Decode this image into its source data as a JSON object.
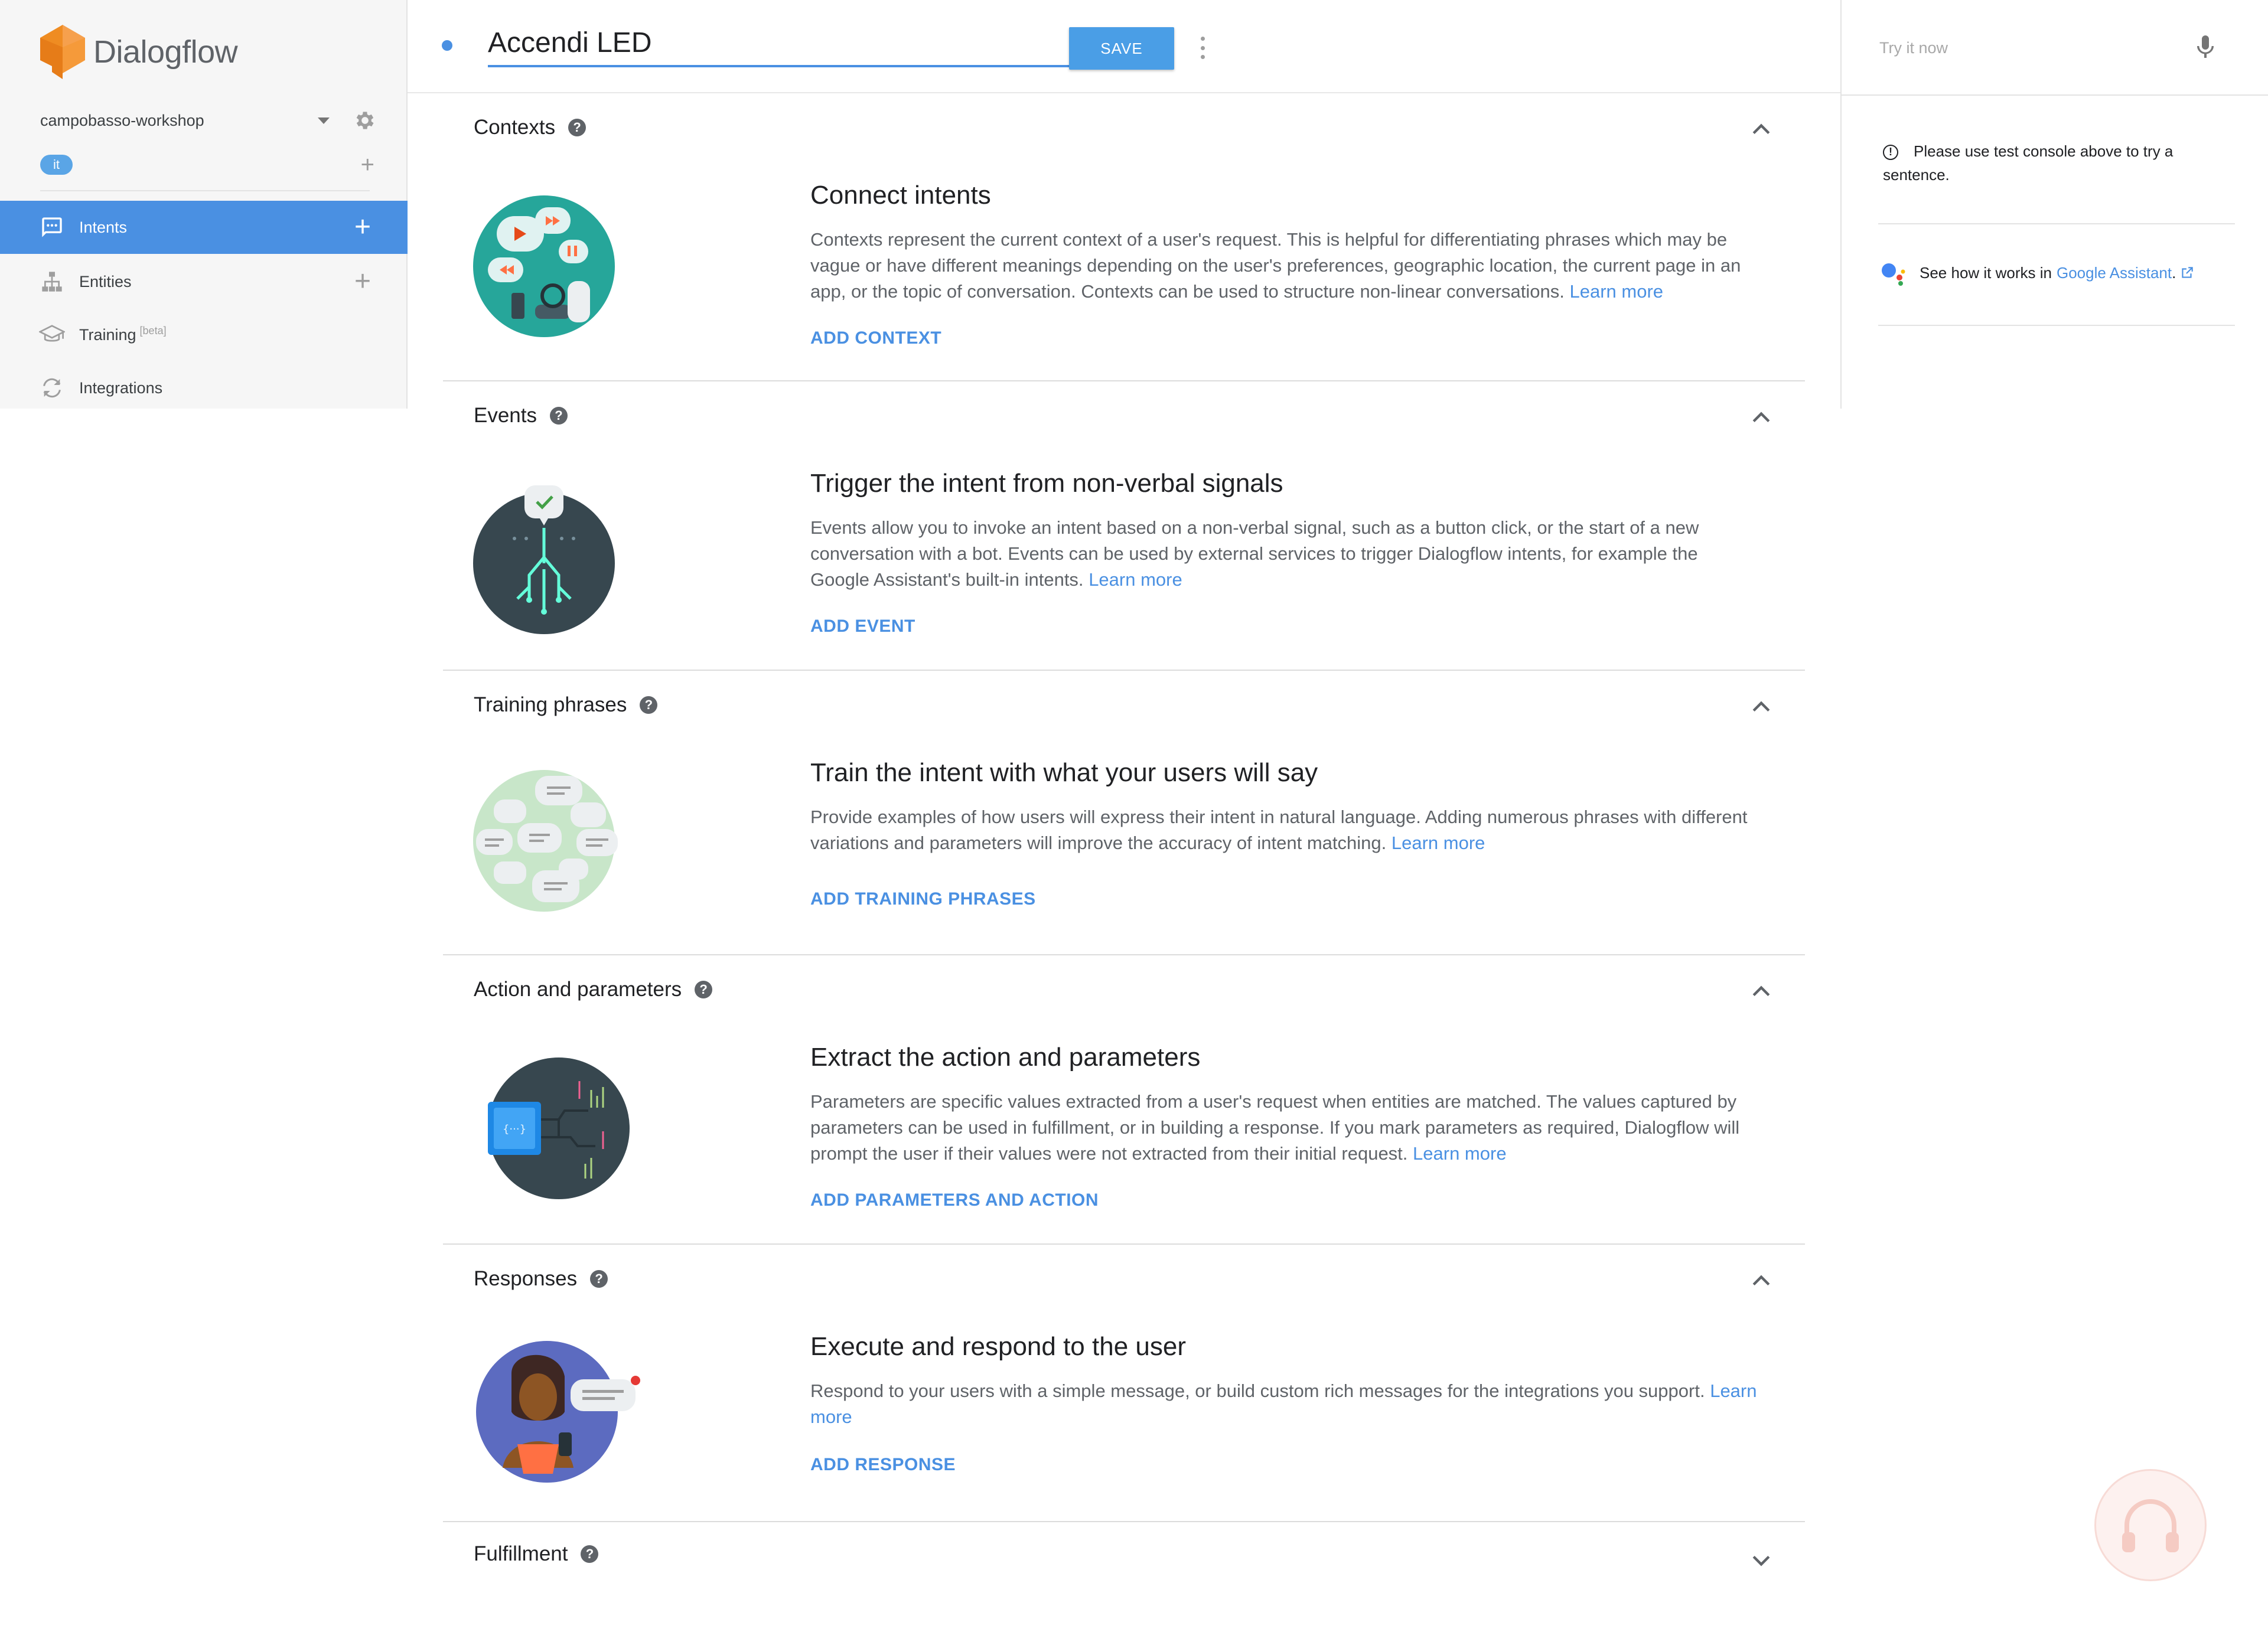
{
  "brand": {
    "name": "Dialogflow",
    "colors": {
      "primary": "#ef8c22",
      "accent": "#4a90e2"
    }
  },
  "sidebar": {
    "agent_name": "campobasso-workshop",
    "language_chip": "it",
    "items": [
      {
        "label": "Intents",
        "icon": "chat-bubble-icon",
        "active": true
      },
      {
        "label": "Entities",
        "icon": "hierarchy-icon"
      },
      {
        "label": "Training",
        "badge": "[beta]",
        "icon": "graduation-cap-icon"
      },
      {
        "label": "Integrations",
        "icon": "sync-icon"
      }
    ]
  },
  "header": {
    "intent_name": "Accendi LED",
    "save_label": "SAVE"
  },
  "console": {
    "try_placeholder": "Try it now",
    "info_text": "Please use test console above to try a sentence.",
    "ga_prefix": "See how it works in",
    "ga_link": "Google Assistant",
    "ga_suffix": "."
  },
  "sections": {
    "contexts": {
      "title": "Contexts",
      "heading": "Connect intents",
      "description": "Contexts represent the current context of a user's request. This is helpful for differentiating phrases which may be vague or have different meanings depending on the user's preferences, geographic location, the current page in an app, or the topic of conversation. Contexts can be used to structure non-linear conversations.",
      "learn_more": "Learn more",
      "action": "ADD CONTEXT"
    },
    "events": {
      "title": "Events",
      "heading": "Trigger the intent from non-verbal signals",
      "description": "Events allow you to invoke an intent based on a non-verbal signal, such as a button click, or the start of a new conversation with a bot. Events can be used by external services to trigger Dialogflow intents, for example the Google Assistant's built-in intents.",
      "learn_more": "Learn more",
      "action": "ADD EVENT"
    },
    "training": {
      "title": "Training phrases",
      "heading": "Train the intent with what your users will say",
      "description": "Provide examples of how users will express their intent in natural language. Adding numerous phrases with different variations and parameters will improve the accuracy of intent matching.",
      "learn_more": "Learn more",
      "action": "ADD TRAINING PHRASES"
    },
    "action": {
      "title": "Action and parameters",
      "heading": "Extract the action and parameters",
      "description": "Parameters are specific values extracted from a user's request when entities are matched. The values captured by parameters can be used in fulfillment, or in building a response. If you mark parameters as required, Dialogflow will prompt the user if their values were not extracted from their initial request.",
      "learn_more": "Learn more",
      "action": "ADD PARAMETERS AND ACTION"
    },
    "responses": {
      "title": "Responses",
      "heading": "Execute and respond to the user",
      "description": "Respond to your users with a simple message, or build custom rich messages for the integrations you support.",
      "learn_more": "Learn more",
      "action": "ADD RESPONSE"
    },
    "fulfillment": {
      "title": "Fulfillment"
    }
  }
}
